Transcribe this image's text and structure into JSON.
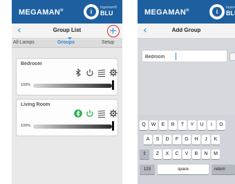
{
  "colors": {
    "brand_blue": "#1d5f9f",
    "accent_blue": "#2a86d6",
    "add_highlight": "#d2212b",
    "power_on_green": "#27b24a"
  },
  "brand": {
    "wordmark": "MEGAMAN",
    "mark": "®",
    "sub": "Ingenium®",
    "product": "BLU"
  },
  "group_list_screen": {
    "back_icon": "chevron-left-icon",
    "title": "Group List",
    "add_icon": "plus-icon",
    "tabs": [
      {
        "label": "All Lamps",
        "active": false
      },
      {
        "label": "Groups",
        "active": true
      },
      {
        "label": "Setup",
        "active": false
      }
    ],
    "groups": [
      {
        "name": "Bedroom",
        "brightness_label": "100%",
        "brightness": 1.0,
        "bluetooth_active": false,
        "power_on": false
      },
      {
        "name": "Living Room",
        "brightness_label": "100%",
        "brightness": 1.0,
        "bluetooth_active": true,
        "power_on": true
      }
    ]
  },
  "add_group_screen": {
    "back_icon": "chevron-left-icon",
    "title": "Add Group",
    "name_input": {
      "value": "Bedroom"
    },
    "keyboard": {
      "row1": [
        "Q",
        "W",
        "E",
        "R",
        "T",
        "Y",
        "U",
        "I",
        "O"
      ],
      "row2": [
        "A",
        "S",
        "D",
        "F",
        "G",
        "H",
        "J",
        "K"
      ],
      "row3": [
        "Z",
        "X",
        "C",
        "V",
        "B",
        "N",
        "M"
      ],
      "shift_icon": "shift-icon",
      "numbers_label": "123",
      "space_label": "space",
      "return_label": "return"
    }
  }
}
